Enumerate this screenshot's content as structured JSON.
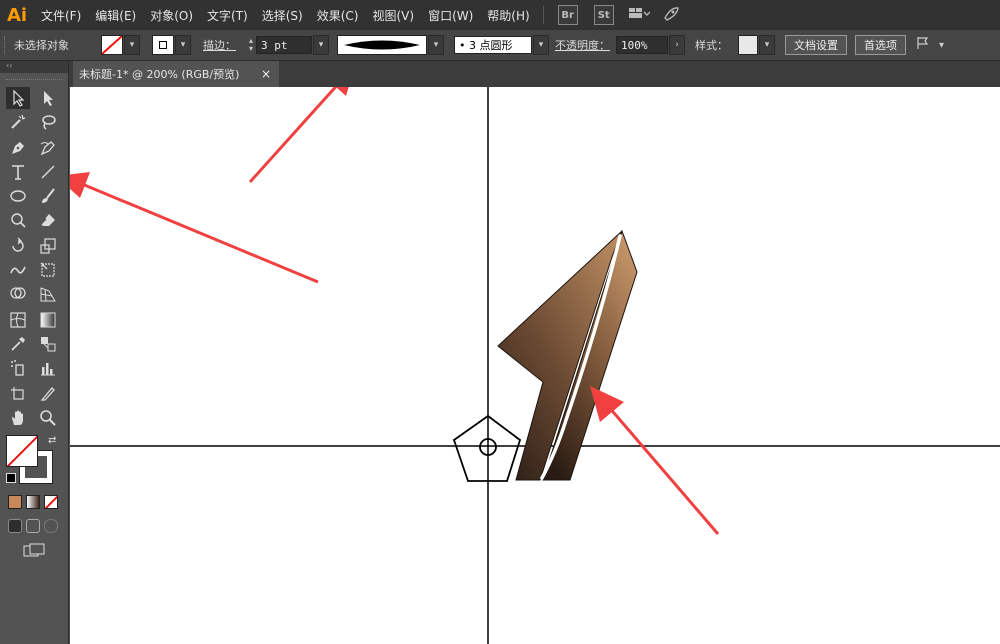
{
  "app": {
    "logo": "Ai"
  },
  "menu": [
    "文件(F)",
    "编辑(E)",
    "对象(O)",
    "文字(T)",
    "选择(S)",
    "效果(C)",
    "视图(V)",
    "窗口(W)",
    "帮助(H)"
  ],
  "menu_badges": [
    "Br",
    "St"
  ],
  "control_bar": {
    "selection_label": "未选择对象",
    "stroke_label": "描边：",
    "stroke_weight": "3 pt",
    "brush_point": "•  3 点圆形",
    "opacity_label": "不透明度：",
    "opacity_value": "100%",
    "style_label": "样式：",
    "doc_setup_button": "文档设置",
    "preferences_button": "首选项"
  },
  "document_tab": {
    "title": "未标题-1* @ 200% (RGB/预览)",
    "close": "×"
  },
  "colors": {
    "menubar": "#323232",
    "panel": "#535353",
    "canvas": "#ffffff",
    "annotation_arrow": "#f04040",
    "gradient_light": "#b98a5f",
    "gradient_dark": "#2e2018",
    "logo": "#ff9a00"
  },
  "icons": {
    "workspace_switcher": "grid-layout-icon",
    "gpu": "rocket-icon",
    "flag": "flag-icon"
  }
}
